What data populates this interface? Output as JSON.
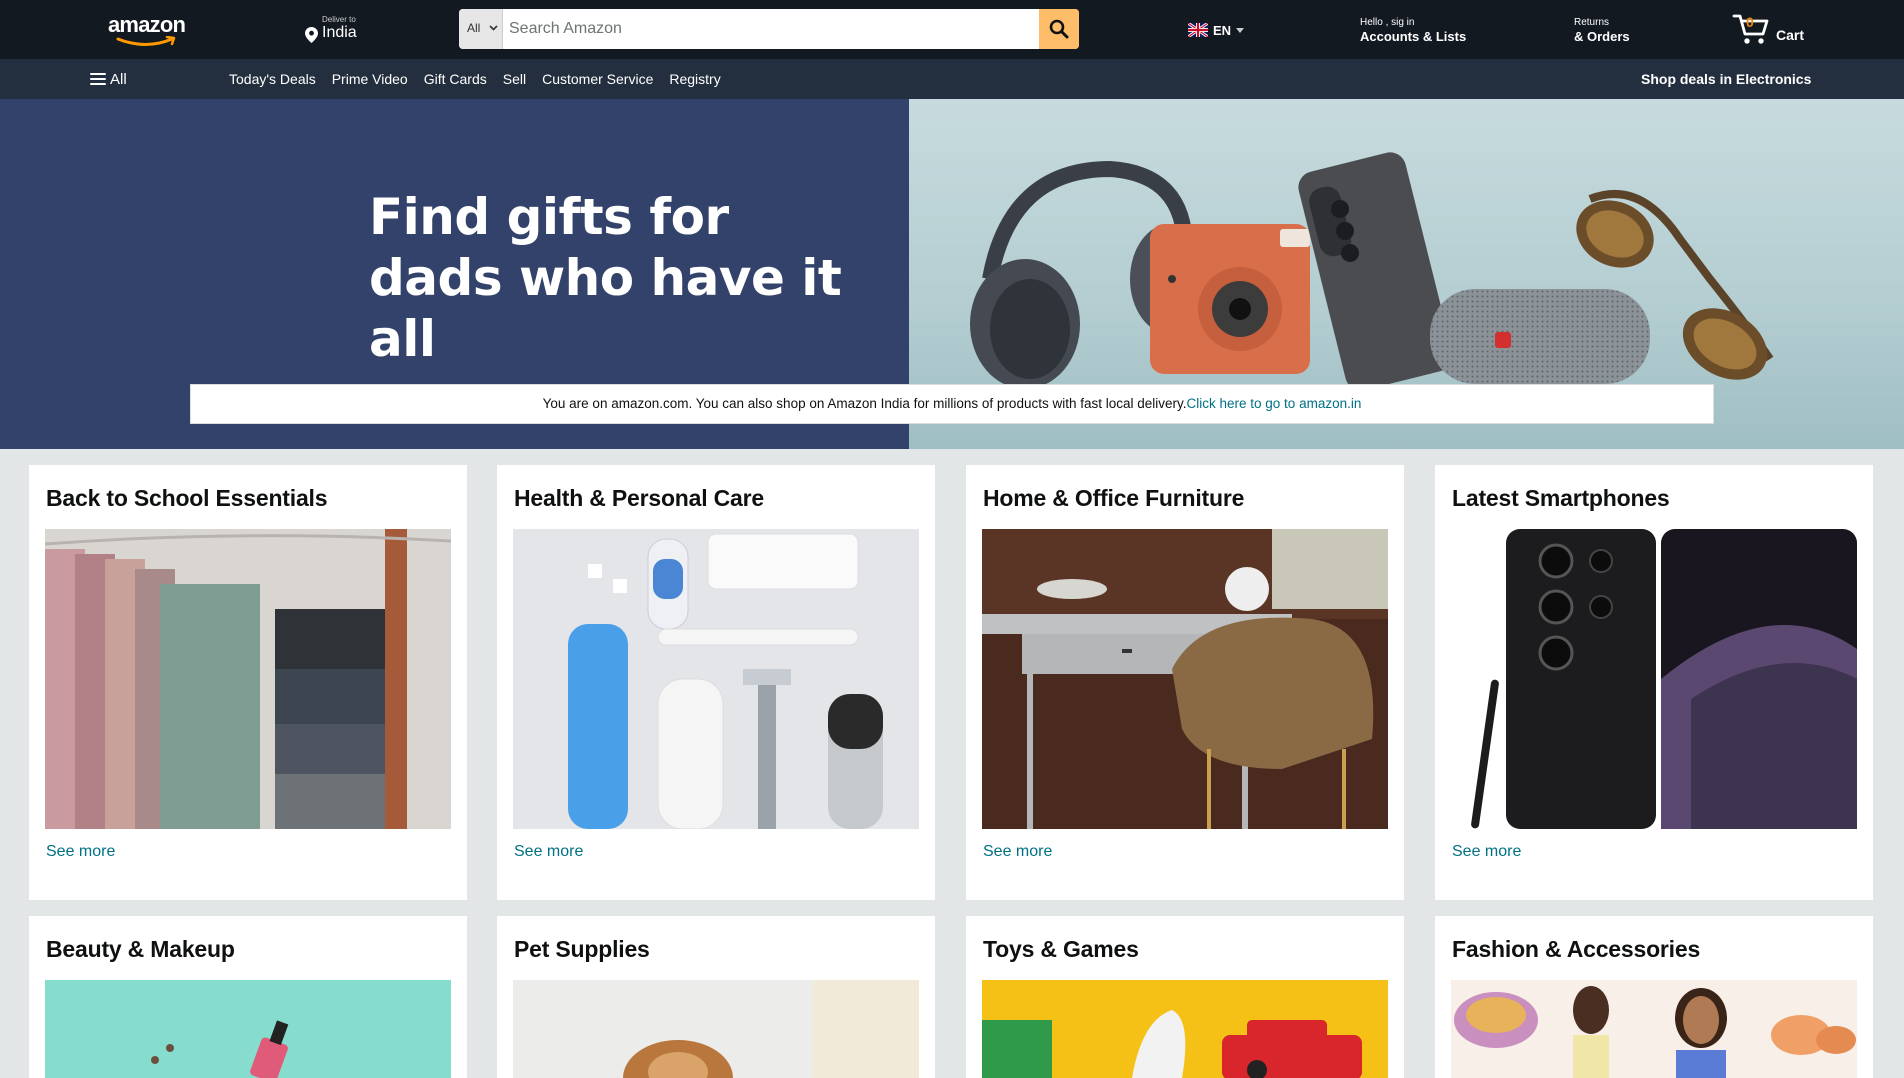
{
  "header": {
    "logo_text": "amazon",
    "deliver_small": "Deliver to",
    "deliver_location": "India",
    "search_category": "All",
    "search_placeholder": "Search Amazon",
    "language": "EN",
    "account_greeting": "Hello , sig in",
    "account_label": "Accounts & Lists",
    "returns_small": "Returns",
    "returns_label": "& Orders",
    "cart_count": "0",
    "cart_label": "Cart"
  },
  "subnav": {
    "all_label": "All",
    "links": [
      "Today's Deals",
      "Prime Video",
      "Gift Cards",
      "Sell",
      "Customer Service",
      "Registry"
    ],
    "promo": "Shop deals in Electronics"
  },
  "hero": {
    "title_line1": "Find gifts for",
    "title_line2": "dads who have it all",
    "notice_text": "You are on amazon.com. You can also shop on Amazon India for millions of products with fast local delivery.",
    "notice_link": "Click here to go to amazon.in"
  },
  "cards": [
    {
      "title": "Back to School Essentials",
      "link": "See more"
    },
    {
      "title": "Health & Personal Care",
      "link": "See more"
    },
    {
      "title": "Home & Office Furniture",
      "link": "See more"
    },
    {
      "title": "Latest Smartphones",
      "link": "See more"
    },
    {
      "title": "Beauty & Makeup",
      "link": ""
    },
    {
      "title": "Pet Supplies",
      "link": ""
    },
    {
      "title": "Toys & Games",
      "link": ""
    },
    {
      "title": "Fashion & Accessories",
      "link": ""
    }
  ],
  "colors": {
    "nav_bg": "#131921",
    "subnav_bg": "#232f3e",
    "search_button": "#febd69",
    "link": "#007185",
    "hero_left": "#33426a",
    "page_bg": "#e3e6e6"
  },
  "icons": [
    "amazon-smile-logo",
    "location-pin-icon",
    "chevron-down-icon",
    "search-icon",
    "uk-flag-icon",
    "caret-down-icon",
    "cart-icon",
    "hamburger-menu-icon"
  ]
}
